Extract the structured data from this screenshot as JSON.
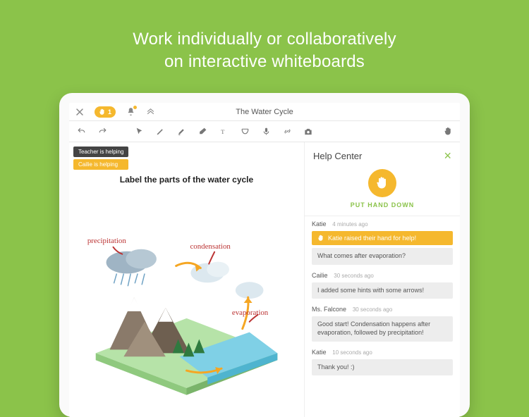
{
  "headline_line1": "Work individually or collaboratively",
  "headline_line2": "on interactive whiteboards",
  "topbar": {
    "title": "The Water Cycle",
    "hand_count": "1"
  },
  "helpers": {
    "teacher": "Teacher is helping",
    "peer": "Cailie is helping"
  },
  "canvas": {
    "prompt": "Label the parts of the water cycle",
    "labels": {
      "precipitation": "precipitation",
      "condensation": "condensation",
      "evaporation": "evaporation"
    }
  },
  "helpcenter": {
    "title": "Help Center",
    "put_hand_down": "PUT HAND DOWN",
    "messages": [
      {
        "author": "Katie",
        "time": "4 minutes ago",
        "event": "Katie raised their hand for help!",
        "body": "What comes after evaporation?"
      },
      {
        "author": "Cailie",
        "time": "30 seconds ago",
        "body": "I added some hints with some arrows!"
      },
      {
        "author": "Ms. Falcone",
        "time": "30 seconds ago",
        "body": "Good start! Condensation happens after evaporation, followed by precipitation!"
      },
      {
        "author": "Katie",
        "time": "10 seconds ago",
        "body": "Thank you! :)"
      }
    ]
  }
}
